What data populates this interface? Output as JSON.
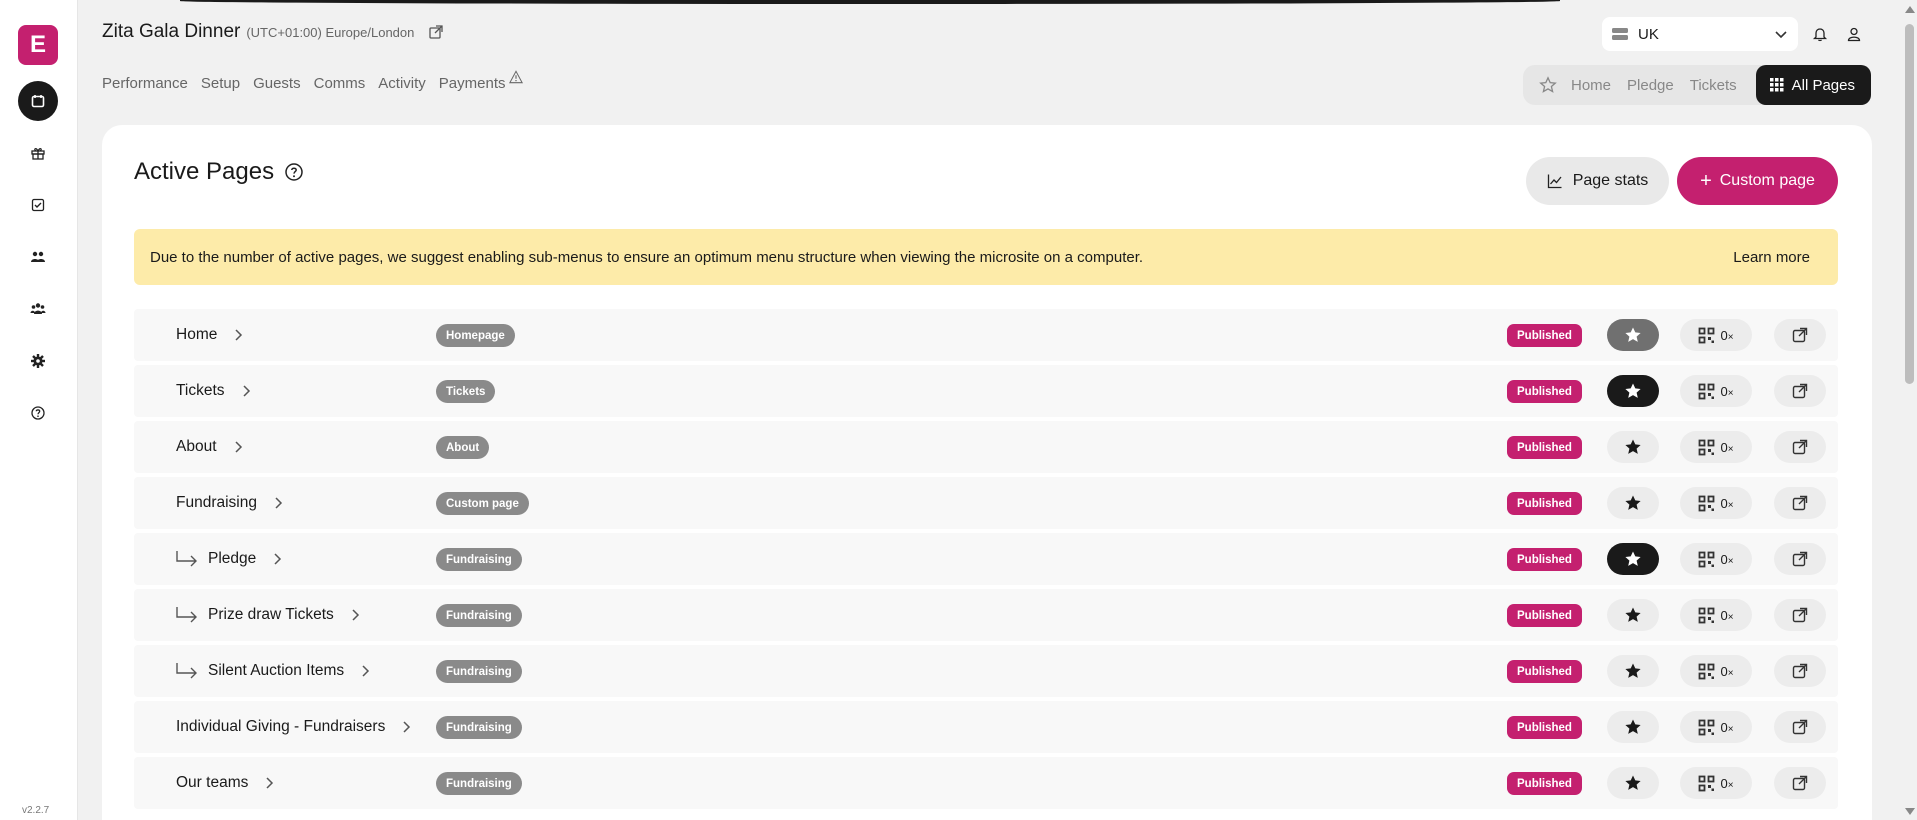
{
  "app": {
    "logo_letter": "E",
    "version": "v2.2.7",
    "accent": "#c4206f"
  },
  "sidebar": {
    "items": [
      {
        "icon": "calendar-icon",
        "active": true
      },
      {
        "icon": "gift-icon",
        "active": false
      },
      {
        "icon": "checklist-icon",
        "active": false
      },
      {
        "icon": "people-icon",
        "active": false
      },
      {
        "icon": "people-group-icon",
        "active": false
      },
      {
        "icon": "gear-icon",
        "active": false
      },
      {
        "icon": "help-icon",
        "active": false
      }
    ]
  },
  "header": {
    "event_title": "Zita Gala Dinner",
    "timezone": "(UTC+01:00) Europe/London",
    "region": "UK",
    "tabs": [
      {
        "label": "Performance"
      },
      {
        "label": "Setup"
      },
      {
        "label": "Guests"
      },
      {
        "label": "Comms"
      },
      {
        "label": "Activity"
      },
      {
        "label": "Payments",
        "warning": true
      }
    ],
    "quicknav": {
      "items": [
        "Home",
        "Pledge",
        "Tickets"
      ],
      "all_pages": "All Pages"
    }
  },
  "main": {
    "title": "Active Pages",
    "page_stats_label": "Page stats",
    "custom_page_label": "Custom page",
    "notice": {
      "text": "Due to the number of active pages, we suggest enabling sub-menus to ensure an optimum menu structure when viewing the microsite on a computer.",
      "learn_more": "Learn more"
    },
    "pages": [
      {
        "name": "Home",
        "type": "Homepage",
        "status": "Published",
        "star": "gray",
        "qr_count": "0",
        "sub": false
      },
      {
        "name": "Tickets",
        "type": "Tickets",
        "status": "Published",
        "star": "dark",
        "qr_count": "0",
        "sub": false
      },
      {
        "name": "About",
        "type": "About",
        "status": "Published",
        "star": "none",
        "qr_count": "0",
        "sub": false
      },
      {
        "name": "Fundraising",
        "type": "Custom page",
        "status": "Published",
        "star": "none",
        "qr_count": "0",
        "sub": false
      },
      {
        "name": "Pledge",
        "type": "Fundraising",
        "status": "Published",
        "star": "dark",
        "qr_count": "0",
        "sub": true
      },
      {
        "name": "Prize draw Tickets",
        "type": "Fundraising",
        "status": "Published",
        "star": "none",
        "qr_count": "0",
        "sub": true
      },
      {
        "name": "Silent Auction Items",
        "type": "Fundraising",
        "status": "Published",
        "star": "none",
        "qr_count": "0",
        "sub": true
      },
      {
        "name": "Individual Giving - Fundraisers",
        "type": "Fundraising",
        "status": "Published",
        "star": "none",
        "qr_count": "0",
        "sub": false
      },
      {
        "name": "Our teams",
        "type": "Fundraising",
        "status": "Published",
        "star": "none",
        "qr_count": "0",
        "sub": false
      }
    ],
    "qr_suffix": "×"
  }
}
